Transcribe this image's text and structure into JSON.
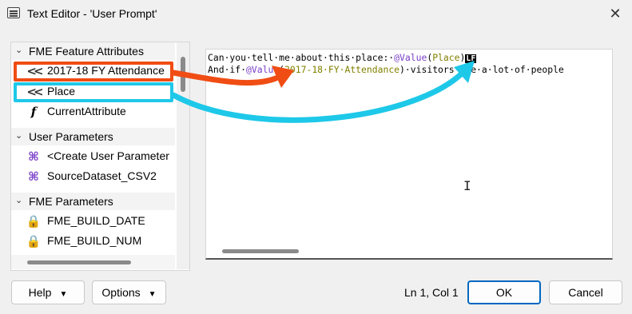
{
  "window": {
    "title": "Text Editor - 'User Prompt'",
    "close_glyph": "✕"
  },
  "sidebar": {
    "sections": [
      {
        "label": "FME Feature Attributes",
        "chevron": "⌄"
      },
      {
        "label": "User Parameters",
        "chevron": "⌄"
      },
      {
        "label": "FME Parameters",
        "chevron": "⌄"
      }
    ],
    "feature_attributes": [
      {
        "label": "2017-18 FY Attendance",
        "icon": "attribute-icon",
        "glyph": "<<"
      },
      {
        "label": "Place",
        "icon": "attribute-icon",
        "glyph": "<<"
      },
      {
        "label": "CurrentAttribute",
        "icon": "function-icon",
        "glyph": "f"
      }
    ],
    "user_parameters": [
      {
        "label": "<Create User Parameter",
        "icon": "user-parameter-icon",
        "glyph": "⌘"
      },
      {
        "label": "SourceDataset_CSV2",
        "icon": "user-parameter-icon",
        "glyph": "⌘"
      }
    ],
    "fme_parameters": [
      {
        "label": "FME_BUILD_DATE",
        "icon": "locked-parameter-icon",
        "glyph": "🔒"
      },
      {
        "label": "FME_BUILD_NUM",
        "icon": "locked-parameter-icon",
        "glyph": "🔒"
      }
    ]
  },
  "editor": {
    "line1": {
      "text_before": "Can·you·tell·me·about·this·place:·",
      "fn": "@Value",
      "open": "(",
      "arg": "Place",
      "close": ")",
      "lf": "LF"
    },
    "line2": {
      "text_before": "And·if·",
      "fn": "@Value",
      "open": "(",
      "arg": "2017-18·FY·Attendance",
      "close": ")",
      "text_after": "·visitors·are·a·lot·of·people"
    }
  },
  "footer": {
    "help_label": "Help",
    "options_label": "Options",
    "status": "Ln 1, Col 1",
    "ok_label": "OK",
    "cancel_label": "Cancel"
  },
  "colors": {
    "highlight_orange": "#f04d14",
    "highlight_blue": "#1ec8e8",
    "function_purple": "#7a3fc8",
    "argument_olive": "#808000",
    "primary_border": "#0067c0"
  }
}
